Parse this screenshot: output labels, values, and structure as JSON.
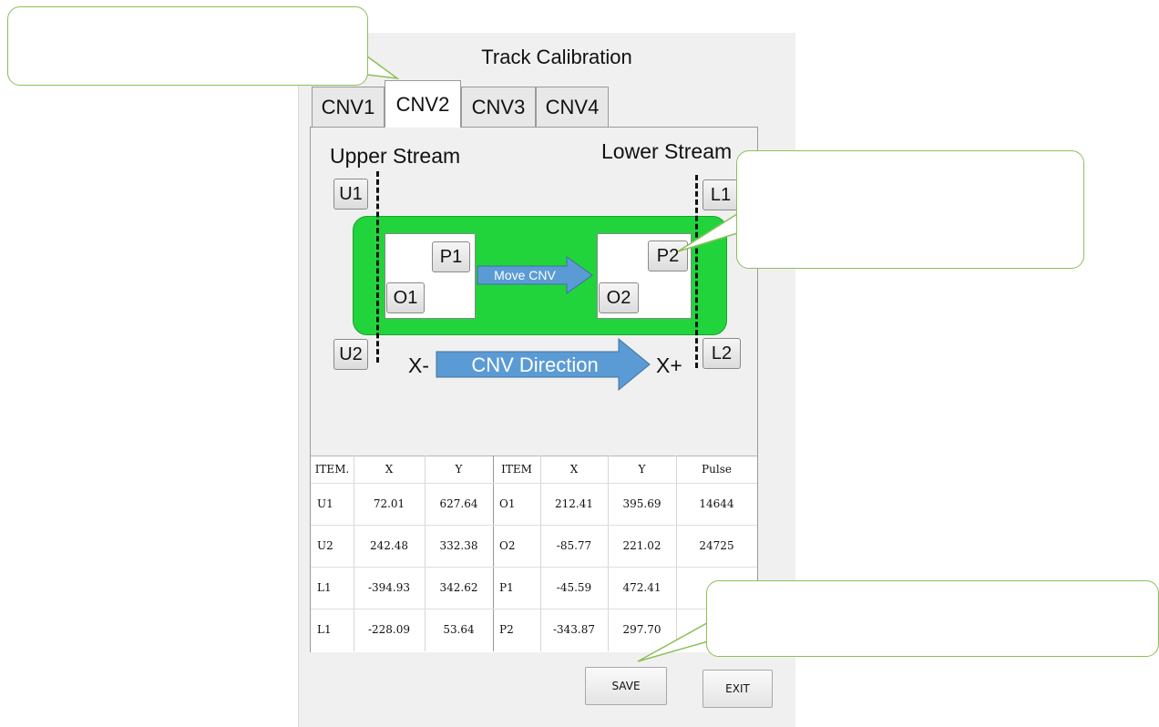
{
  "window": {
    "title": "Track Calibration"
  },
  "tabs": [
    {
      "label": "CNV1",
      "active": false
    },
    {
      "label": "CNV2",
      "active": true
    },
    {
      "label": "CNV3",
      "active": false
    },
    {
      "label": "CNV4",
      "active": false
    }
  ],
  "diagram": {
    "upper_stream": "Upper Stream",
    "lower_stream": "Lower Stream",
    "markers": {
      "u1": "U1",
      "u2": "U2",
      "l1": "L1",
      "l2": "L2",
      "p1": "P1",
      "p2": "P2",
      "o1": "O1",
      "o2": "O2"
    },
    "move_label": "Move CNV",
    "x_minus": "X-",
    "x_plus": "X+",
    "direction_label": "CNV Direction",
    "colors": {
      "belt": "#22d43c",
      "arrow": "#5b9bd5"
    }
  },
  "table_left": {
    "headers": [
      "ITEM.",
      "X",
      "Y"
    ],
    "rows": [
      [
        "U1",
        "72.01",
        "627.64"
      ],
      [
        "U2",
        "242.48",
        "332.38"
      ],
      [
        "L1",
        "-394.93",
        "342.62"
      ],
      [
        "L1",
        "-228.09",
        "53.64"
      ]
    ]
  },
  "table_right": {
    "headers": [
      "ITEM",
      "X",
      "Y",
      "Pulse"
    ],
    "rows": [
      [
        "O1",
        "212.41",
        "395.69",
        "14644"
      ],
      [
        "O2",
        "-85.77",
        "221.02",
        "24725"
      ],
      [
        "P1",
        "-45.59",
        "472.41",
        ""
      ],
      [
        "P2",
        "-343.87",
        "297.70",
        ""
      ]
    ]
  },
  "actions": {
    "save": "SAVE",
    "exit": "EXIT"
  },
  "callouts": {
    "top_left": "",
    "right": "",
    "bottom_right": "",
    "border_color": "#8cbf5a"
  }
}
